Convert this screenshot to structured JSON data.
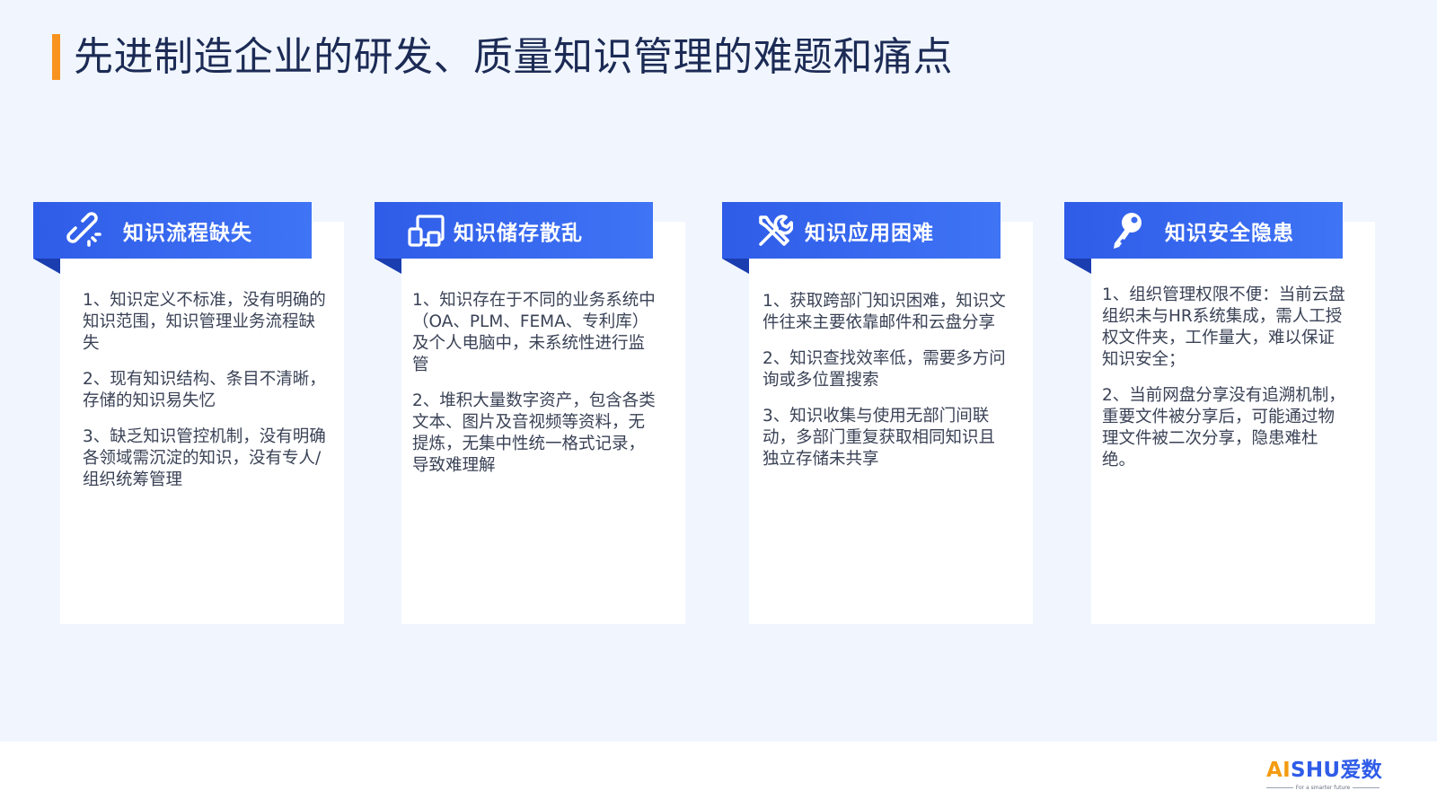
{
  "title": "先进制造企业的研发、质量知识管理的难题和痛点",
  "colors": {
    "accent": "#f7931e",
    "header_blue": "#2f5ce8",
    "fold_blue": "#1a3db0",
    "background": "#f1f6fe"
  },
  "cards": [
    {
      "title": "知识流程缺失",
      "icon": "broken-link-icon",
      "items": [
        "1、知识定义不标准，没有明确的知识范围，知识管理业务流程缺失",
        "2、现有知识结构、条目不清晰，存储的知识易失忆",
        "3、缺乏知识管控机制，没有明确各领域需沉淀的知识，没有专人/组织统筹管理"
      ]
    },
    {
      "title": "知识储存散乱",
      "icon": "devices-icon",
      "items": [
        "1、知识存在于不同的业务系统中（OA、PLM、FEMA、专利库）及个人电脑中，未系统性进行监管",
        "2、堆积大量数字资产，包含各类文本、图片及音视频等资料，无提炼，无集中性统一格式记录，导致难理解"
      ]
    },
    {
      "title": "知识应用困难",
      "icon": "tools-icon",
      "items": [
        "1、获取跨部门知识困难，知识文件往来主要依靠邮件和云盘分享",
        "2、知识查找效率低，需要多方问询或多位置搜索",
        "3、知识收集与使用无部门间联动，多部门重复获取相同知识且独立存储未共享"
      ]
    },
    {
      "title": "知识安全隐患",
      "icon": "key-icon",
      "items": [
        "1、组织管理权限不便：当前云盘组织未与HR系统集成，需人工授权文件夹，工作量大，难以保证知识安全；",
        "2、当前网盘分享没有追溯机制，重要文件被分享后，可能通过物理文件被二次分享，隐患难杜绝。"
      ]
    }
  ],
  "footer": {
    "logo_ai": "AI",
    "logo_shu": "SHU",
    "logo_cn": "爱数",
    "tagline": "For a smarter future"
  }
}
